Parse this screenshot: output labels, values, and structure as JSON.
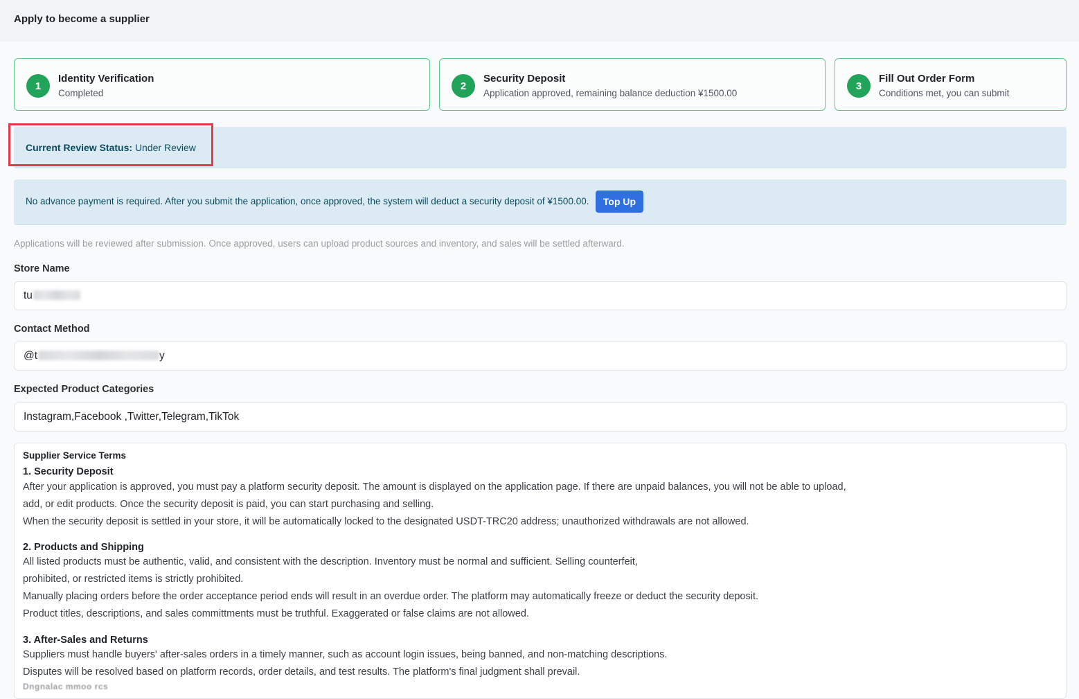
{
  "header": {
    "title": "Apply to become a supplier"
  },
  "steps": [
    {
      "num": "1",
      "title": "Identity Verification",
      "desc": "Completed"
    },
    {
      "num": "2",
      "title": "Security Deposit",
      "desc": "Application approved, remaining balance deduction ¥1500.00"
    },
    {
      "num": "3",
      "title": "Fill Out Order Form",
      "desc": "Conditions met, you can submit"
    }
  ],
  "status": {
    "label": "Current Review Status:",
    "value": "Under Review"
  },
  "info": {
    "text": "No advance payment is required. After you submit the application, once approved, the system will deduct a security deposit of ¥1500.00.",
    "button": "Top Up"
  },
  "note": "Applications will be reviewed after submission. Once approved, users can upload product sources and inventory, and sales will be settled afterward.",
  "form": {
    "store_name": {
      "label": "Store Name",
      "value": "tu"
    },
    "contact": {
      "label": "Contact Method",
      "value": "@t",
      "value_tail": "y"
    },
    "categories": {
      "label": "Expected Product Categories",
      "value": "Instagram,Facebook ,Twitter,Telegram,TikTok"
    }
  },
  "terms": {
    "title": "Supplier Service Terms",
    "sections": [
      {
        "title": "1. Security Deposit",
        "lines": [
          "After your application is approved, you must pay a platform security deposit. The amount is displayed on the application page. If there are unpaid balances, you will not be able to upload,",
          "add, or edit products. Once the security deposit is paid, you can start purchasing and selling.",
          "When the security deposit is settled in your store, it will be automatically locked to the designated USDT-TRC20 address; unauthorized withdrawals are not allowed."
        ]
      },
      {
        "title": "2. Products and Shipping",
        "lines": [
          "All listed products must be authentic, valid, and consistent with the description. Inventory must be normal and sufficient. Selling counterfeit,",
          "prohibited, or restricted items is strictly prohibited.",
          "Manually placing orders before the order acceptance period ends will result in an overdue order. The platform may automatically freeze or deduct the security deposit.",
          "Product titles, descriptions, and sales committments must be truthful. Exaggerated or false claims are not allowed."
        ]
      },
      {
        "title": "3. After-Sales and Returns",
        "lines": [
          "Suppliers must handle buyers' after-sales orders in a timely manner, such as account login issues, being banned, and non-matching descriptions.",
          "Disputes will be resolved based on platform records, order details, and test results. The platform's final judgment shall prevail."
        ]
      }
    ],
    "faded_text": "Dngnalac mmoo rcs"
  }
}
